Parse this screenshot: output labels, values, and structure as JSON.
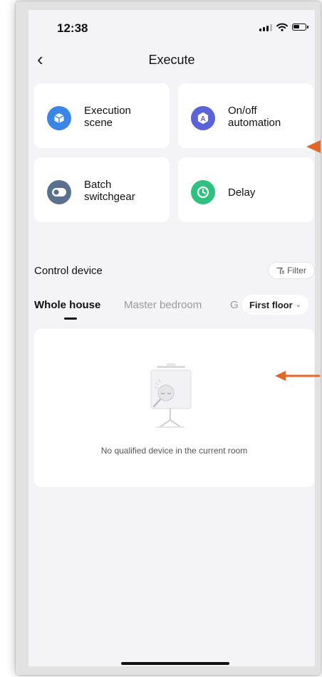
{
  "status_bar": {
    "time": "12:38"
  },
  "header": {
    "title": "Execute"
  },
  "action_cards": [
    {
      "label": "Execution\nscene",
      "icon": "cube-icon",
      "color": "#3a86e8"
    },
    {
      "label": "On/off\nautomation",
      "icon": "automation-icon",
      "color": "#5a63d8"
    },
    {
      "label": "Batch\nswitchgear",
      "icon": "switch-icon",
      "color": "#5b6f8e"
    },
    {
      "label": "Delay",
      "icon": "clock-icon",
      "color": "#2ec27e"
    }
  ],
  "control_device": {
    "title": "Control device",
    "filter_label": "Filter",
    "tabs": [
      "Whole house",
      "Master bedroom",
      "G"
    ],
    "active_tab": "Whole house",
    "floor_selector": "First floor",
    "empty_message": "No qualified device in the current room"
  },
  "annotation_color": "#e2682a"
}
